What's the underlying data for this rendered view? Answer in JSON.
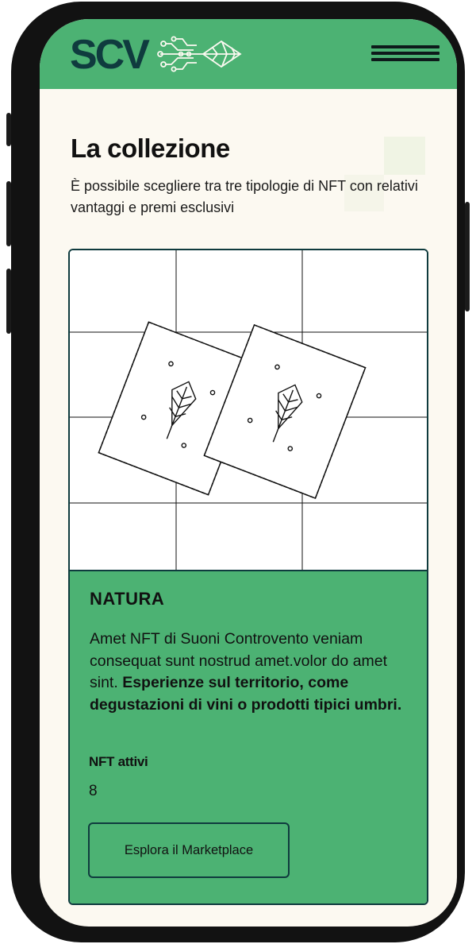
{
  "header": {
    "logo_text": "SCV",
    "menu_icon": "hamburger-icon"
  },
  "intro": {
    "title": "La collezione",
    "subtitle": "È possibile scegliere tra tre tipologie di NFT con relativi vantaggi e premi esclusivi"
  },
  "card": {
    "image_icon": "stamp-leaf-icon",
    "title": "NATURA",
    "description_plain": "Amet NFT di Suoni Controvento veniam consequat sunt nostrud amet.volor do amet sint.",
    "description_bold": "Esperienze sul territorio, come degustazioni di vini o prodotti tipici umbri.",
    "nft_label": "NFT attivi",
    "nft_value": "8",
    "cta_label": "Esplora il Marketplace"
  },
  "colors": {
    "brand_green": "#4cb273",
    "dark_teal": "#0f3b3e",
    "background": "#fcf9f1"
  }
}
